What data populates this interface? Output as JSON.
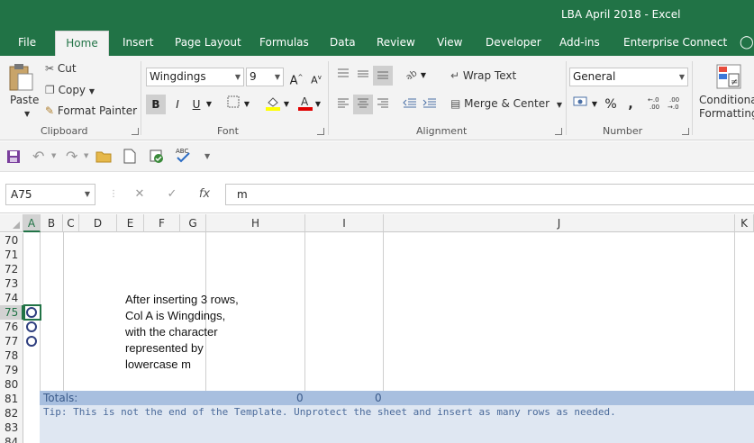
{
  "window": {
    "title": "LBA April 2018  -  Excel"
  },
  "tabs": [
    "File",
    "Home",
    "Insert",
    "Page Layout",
    "Formulas",
    "Data",
    "Review",
    "View",
    "Developer",
    "Add-ins",
    "Enterprise Connect"
  ],
  "ribbon": {
    "clipboard": {
      "paste": "Paste",
      "cut": "Cut",
      "copy": "Copy",
      "format_painter": "Format Painter",
      "label": "Clipboard"
    },
    "font": {
      "name": "Wingdings",
      "size": "9",
      "bold": "B",
      "italic": "I",
      "underline": "U",
      "label": "Font"
    },
    "alignment": {
      "wrap_text": "Wrap Text",
      "merge_center": "Merge & Center",
      "label": "Alignment"
    },
    "number": {
      "format": "General",
      "percent": "%",
      "comma": ",",
      "label": "Number"
    },
    "styles": {
      "conditional_formatting": "Conditional Formatting"
    }
  },
  "formula_bar": {
    "name_box": "A75",
    "formula": "m"
  },
  "columns": [
    "A",
    "B",
    "C",
    "D",
    "E",
    "F",
    "G",
    "H",
    "I",
    "J",
    "K"
  ],
  "rows": [
    "70",
    "71",
    "72",
    "73",
    "74",
    "75",
    "76",
    "77",
    "78",
    "79",
    "80",
    "81",
    "82",
    "83",
    "84"
  ],
  "selected_cell": {
    "column": "A",
    "row": "75"
  },
  "note_lines": [
    "After inserting 3 rows,",
    "Col A is Wingdings,",
    "with the character",
    "represented by",
    "lowercase m"
  ],
  "totals": {
    "label": "Totals:",
    "h_value": "0",
    "i_value": "0"
  },
  "tip": "Tip: This is not the end of the Template.  Unprotect the sheet and insert as many rows as needed.",
  "colors": {
    "accent": "#217346",
    "totals_band": "#a8bfdf",
    "tip_band": "#dfe7f2"
  }
}
